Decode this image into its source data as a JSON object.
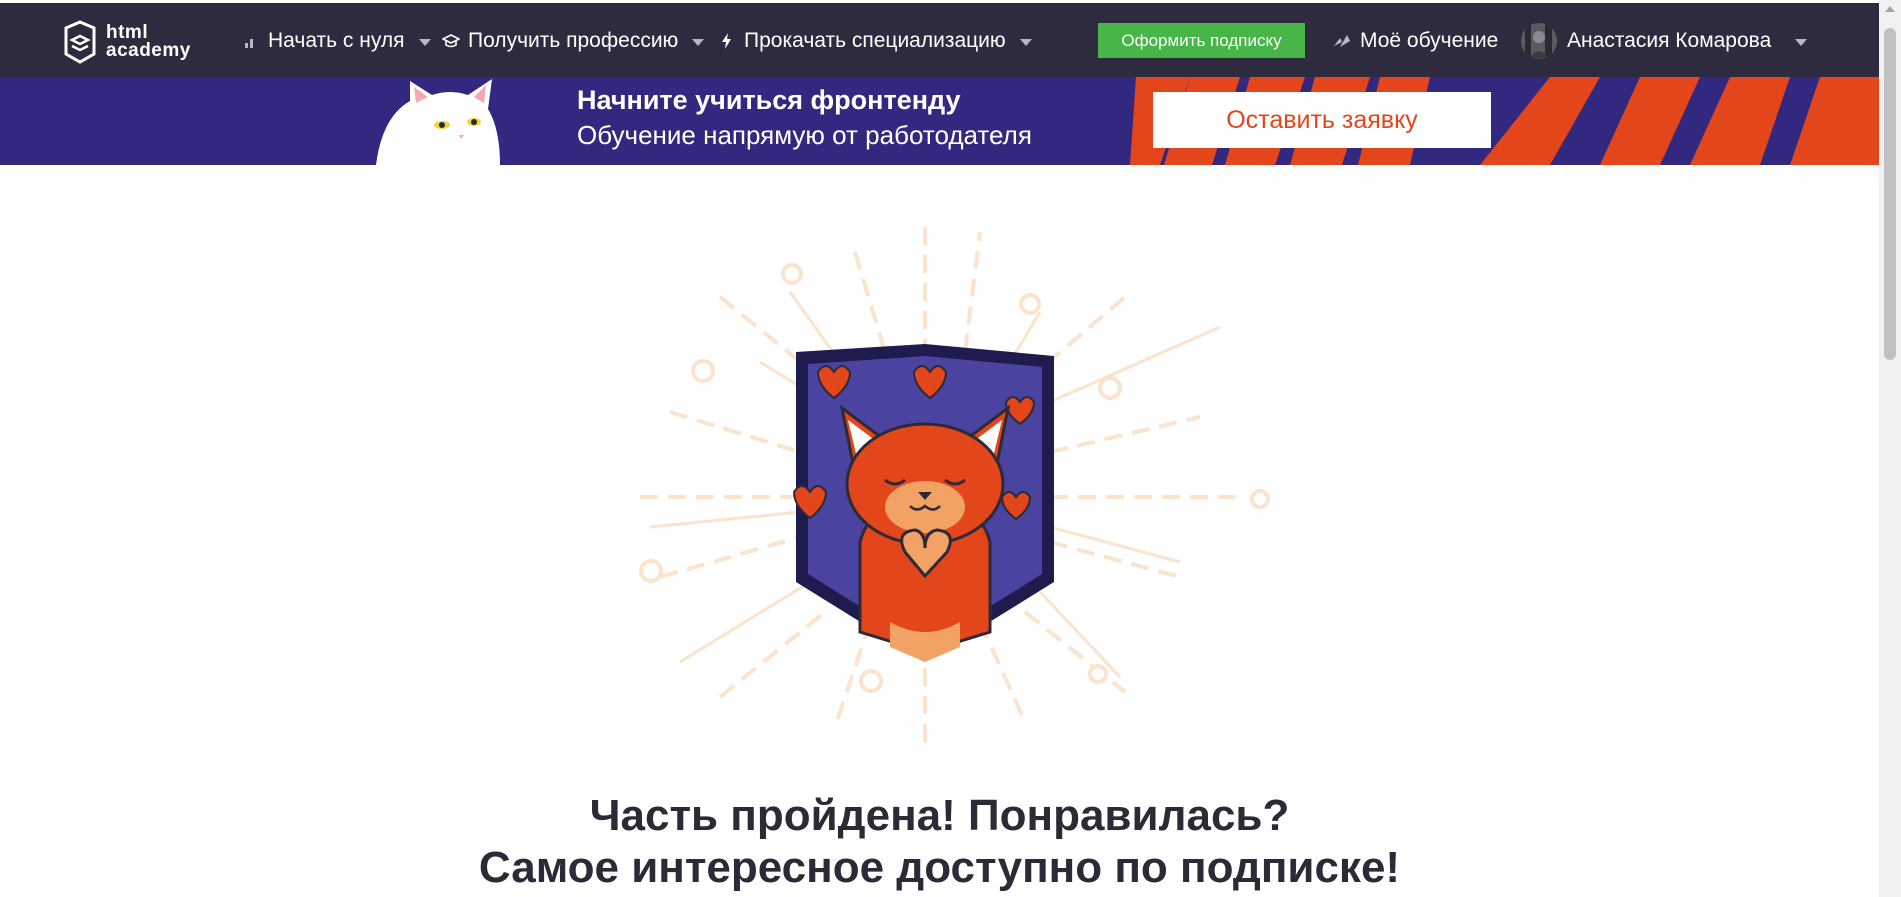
{
  "topnav": {
    "logo": {
      "line1": "html",
      "line2": "academy"
    },
    "items": [
      {
        "label": "Начать с нуля",
        "icon": "bar-chart-icon"
      },
      {
        "label": "Получить профессию",
        "icon": "graduation-cap-icon"
      },
      {
        "label": "Прокачать специализацию",
        "icon": "lightning-icon"
      }
    ],
    "subscribe_label": "Оформить подписку",
    "my_learning_label": "Моё обучение",
    "user_name": "Анастасия Комарова"
  },
  "banner": {
    "title": "Начните учиться фронтенду",
    "subtitle": "Обучение напрямую от работодателя",
    "cta_label": "Оставить заявку"
  },
  "main": {
    "heading_line1": "Часть пройдена! Понравилась?",
    "heading_line2": "Самое интересное доступно по подписке!"
  },
  "colors": {
    "nav_bg": "#2d2b3d",
    "banner_bg": "#33287f",
    "subscribe_green": "#48b548",
    "accent_orange": "#e3461a",
    "badge_blue": "#4b43a0"
  }
}
